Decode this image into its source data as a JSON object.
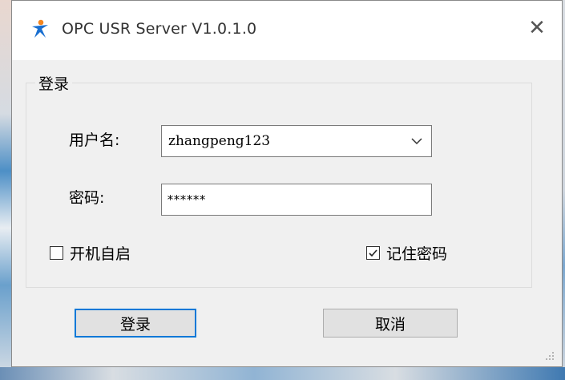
{
  "window": {
    "title": "OPC USR Server V1.0.1.0",
    "close_glyph": "✕",
    "icon": "usr-logo-icon"
  },
  "login_group": {
    "legend": "登录",
    "username_label": "用户名:",
    "username_value": "zhangpeng123",
    "password_label": "密码:",
    "password_value": "******",
    "autostart_label": "开机自启",
    "autostart_checked": false,
    "remember_label": "记住密码",
    "remember_checked": true
  },
  "buttons": {
    "login_label": "登录",
    "cancel_label": "取消"
  },
  "colors": {
    "accent": "#0078d7",
    "icon_blue": "#1a6fd0",
    "icon_orange": "#f5861f"
  }
}
